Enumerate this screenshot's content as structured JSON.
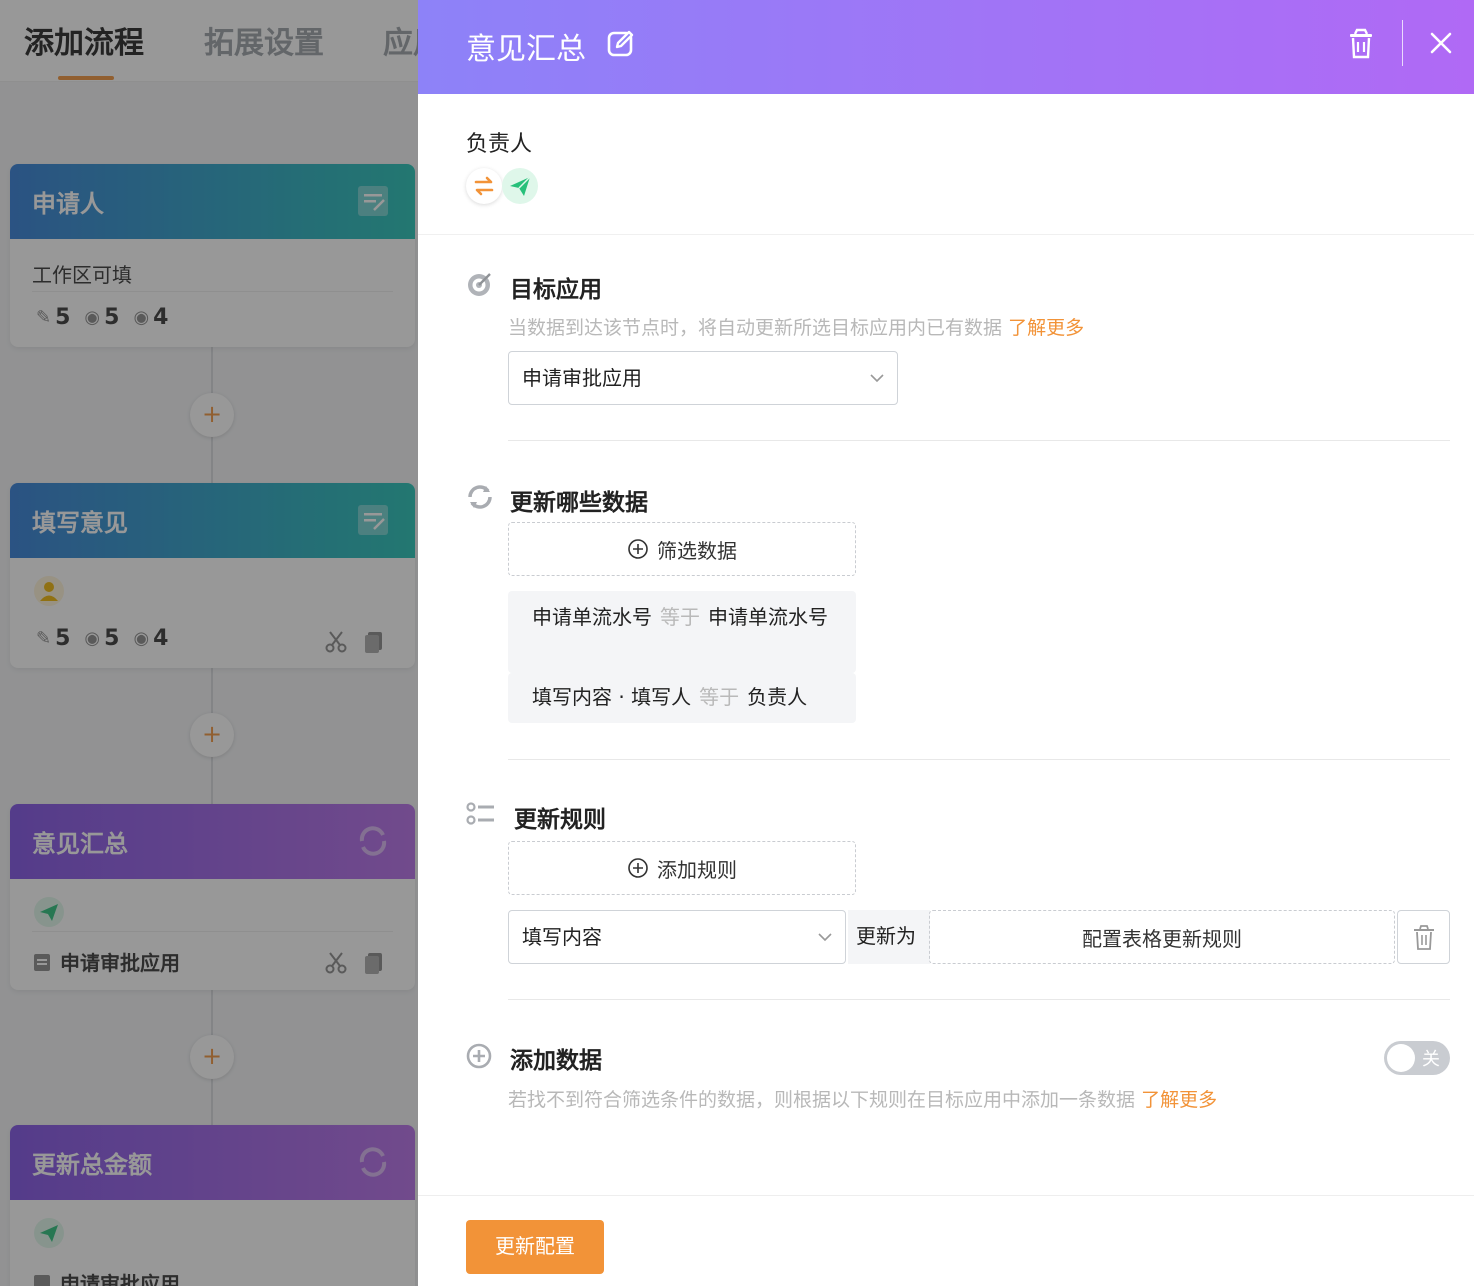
{
  "topbar": {
    "tabs": [
      {
        "label": "添加流程"
      },
      {
        "label": "拓展设置"
      },
      {
        "label": "应用"
      }
    ]
  },
  "flow": {
    "nodes": [
      {
        "title": "申请人",
        "subtitle": "工作区可填",
        "stats": {
          "edit": "5",
          "hidden": "5",
          "view": "4"
        }
      },
      {
        "title": "填写意见",
        "stats": {
          "edit": "5",
          "hidden": "5",
          "view": "4"
        }
      },
      {
        "title": "意见汇总",
        "app": "申请审批应用"
      },
      {
        "title": "更新总金额",
        "app": "申请审批应用"
      }
    ],
    "add_symbol": "+"
  },
  "drawer": {
    "title": "意见汇总",
    "owner": {
      "label": "负责人"
    },
    "target": {
      "title": "目标应用",
      "desc": "当数据到达该节点时，将自动更新所选目标应用内已有数据",
      "link": "了解更多",
      "selected": "申请审批应用"
    },
    "filter": {
      "title": "更新哪些数据",
      "button": "筛选数据",
      "conditions": [
        {
          "left": "申请单流水号",
          "op": "等于",
          "right": "申请单流水号"
        },
        {
          "left": "填写内容 · 填写人",
          "op": "等于",
          "right": "负责人"
        }
      ]
    },
    "rules": {
      "title": "更新规则",
      "button": "添加规则",
      "field": "填写内容",
      "update_to": "更新为",
      "config": "配置表格更新规则"
    },
    "add_data": {
      "title": "添加数据",
      "desc": "若找不到符合筛选条件的数据，则根据以下规则在目标应用中添加一条数据",
      "link": "了解更多",
      "toggle_label": "关",
      "enabled": false
    },
    "submit": "更新配置"
  },
  "colors": {
    "accent": "#f29338",
    "header_gradient_start": "#8d82f8",
    "header_gradient_end": "#b069f5",
    "teal_node": "#1fc1b4",
    "purple_node": "#7d4fe5",
    "green_icon": "#27c07a"
  }
}
